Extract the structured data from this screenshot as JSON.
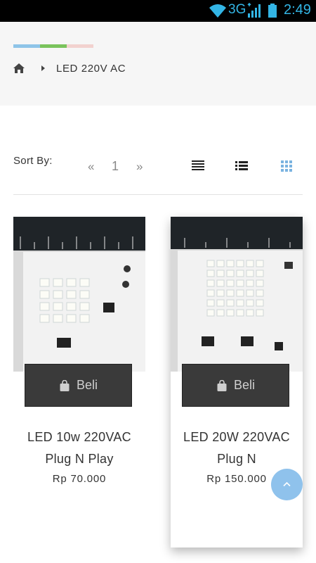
{
  "status_bar": {
    "network": "3G",
    "time": "2:49",
    "accent": "#33b5e5"
  },
  "header": {
    "strip_colors": [
      "#8ec4e8",
      "#7ac35c",
      "#f2d2cf"
    ],
    "breadcrumb": {
      "home_icon": "home-icon",
      "current": "LED 220V AC"
    }
  },
  "toolbar": {
    "sort_label": "Sort By:",
    "pagination": {
      "prev": "«",
      "page": "1",
      "next": "»"
    },
    "views": [
      "list-compact-icon",
      "list-icon",
      "grid-icon"
    ],
    "active_view_color": "#7ab3e0"
  },
  "products": [
    {
      "name": "LED 10w 220VAC Plug N Play",
      "price": "Rp 70.000",
      "buy_label": "Beli"
    },
    {
      "name": "LED 20W 220VAC Plug N",
      "price": "Rp 150.000",
      "buy_label": "Beli"
    }
  ],
  "scroll_top": {
    "icon": "chevron-up-icon",
    "color": "#8fc2ec"
  }
}
